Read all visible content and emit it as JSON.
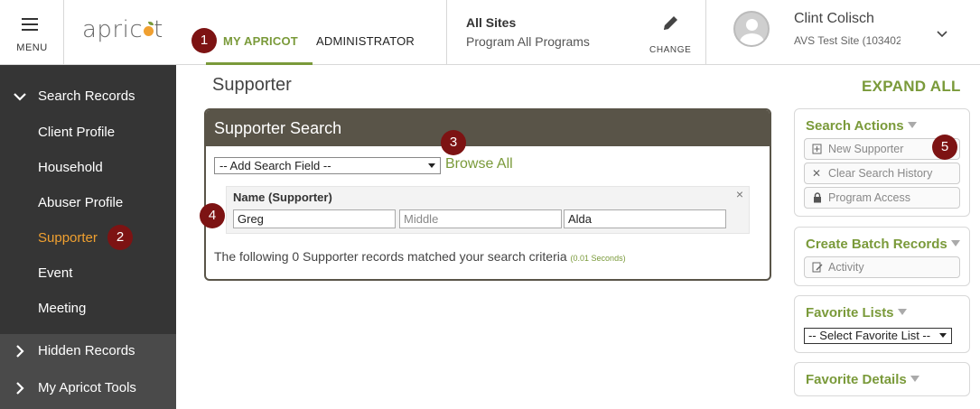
{
  "topbar": {
    "menu_label": "MENU",
    "logo_text_a": "apric",
    "logo_text_b": "t",
    "tabs": [
      {
        "label": "MY APRICOT",
        "active": true
      },
      {
        "label": "ADMINISTRATOR",
        "active": false
      }
    ],
    "sites": {
      "title": "All Sites",
      "program": "Program All Programs",
      "change_label": "CHANGE"
    },
    "user": {
      "name": "Clint Colisch",
      "site": "AVS Test Site (103402)"
    }
  },
  "sidebar": {
    "section_open": "Search Records",
    "items": [
      {
        "label": "Client Profile",
        "active": false
      },
      {
        "label": "Household",
        "active": false
      },
      {
        "label": "Abuser Profile",
        "active": false
      },
      {
        "label": "Supporter",
        "active": true
      },
      {
        "label": "Event",
        "active": false
      },
      {
        "label": "Meeting",
        "active": false
      }
    ],
    "collapsed_sections": [
      "Hidden Records",
      "My Apricot Tools"
    ]
  },
  "main": {
    "page_title": "Supporter",
    "expand_all": "EXPAND ALL",
    "panel": {
      "title": "Supporter Search",
      "add_field_selected": "-- Add Search Field --",
      "browse_all": "Browse All",
      "criteria": {
        "name_label": "Name (Supporter)",
        "first": "Greg",
        "middle_placeholder": "Middle",
        "last": "Alda",
        "remove": "×"
      },
      "result_text": "The following 0 Supporter records matched your search criteria",
      "result_time": "(0.01 Seconds)"
    }
  },
  "right": {
    "search_actions": {
      "title": "Search Actions",
      "buttons": [
        {
          "label": "New Supporter",
          "icon": "new-doc-icon"
        },
        {
          "label": "Clear Search History",
          "icon": "x-icon"
        },
        {
          "label": "Program Access",
          "icon": "lock-icon"
        }
      ]
    },
    "batch": {
      "title": "Create Batch Records",
      "buttons": [
        {
          "label": "Activity",
          "icon": "edit-doc-icon"
        }
      ]
    },
    "favorite_lists": {
      "title": "Favorite Lists",
      "selected": "-- Select Favorite List --"
    },
    "favorite_details": {
      "title": "Favorite Details"
    }
  },
  "badges": [
    "1",
    "2",
    "3",
    "4",
    "5"
  ],
  "colors": {
    "accent_green": "#7a9a3a",
    "accent_orange": "#f0a030",
    "badge_red": "#7d1313",
    "panel_header": "#595448",
    "sidebar": "#4a4a4a"
  }
}
